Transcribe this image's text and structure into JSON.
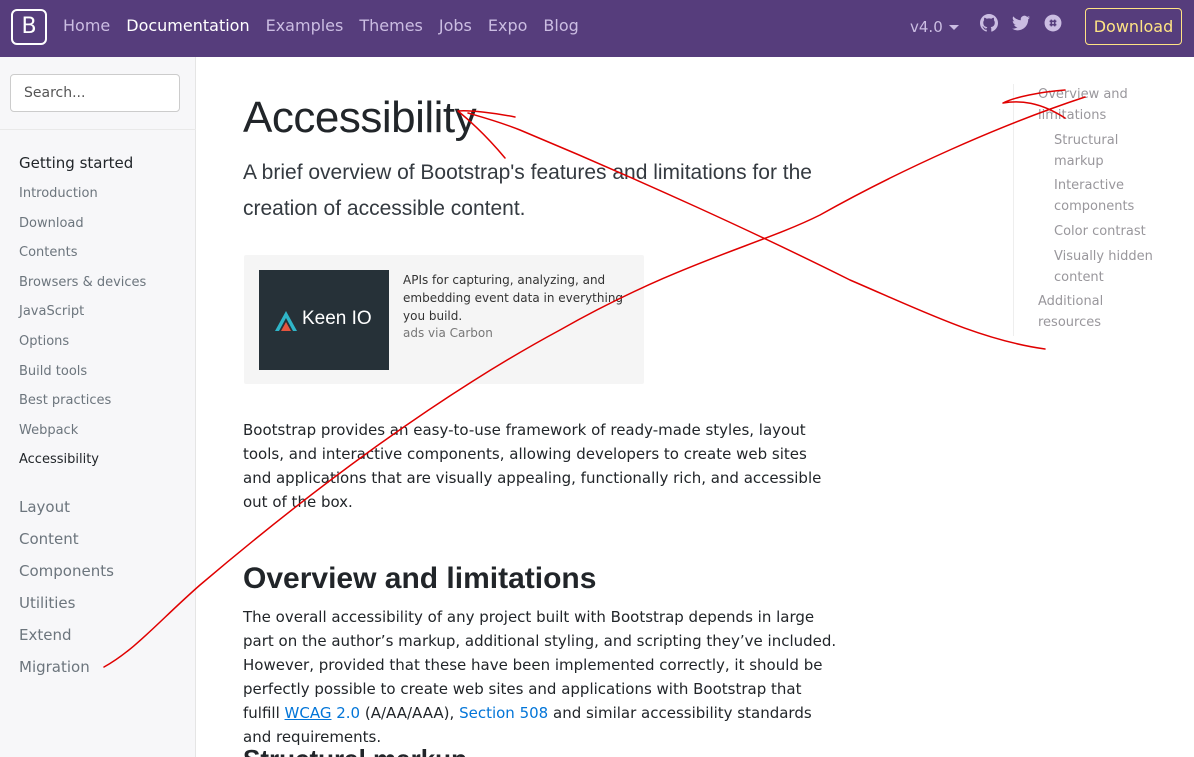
{
  "navbar": {
    "brand": "B",
    "links": [
      "Home",
      "Documentation",
      "Examples",
      "Themes",
      "Jobs",
      "Expo",
      "Blog"
    ],
    "active_link": "Documentation",
    "version": "v4.0",
    "download": "Download",
    "colors": {
      "background": "#563d7c",
      "download_border": "#ffe484"
    }
  },
  "sidebar": {
    "search_placeholder": "Search...",
    "getting_started": "Getting started",
    "items": [
      "Introduction",
      "Download",
      "Contents",
      "Browsers & devices",
      "JavaScript",
      "Options",
      "Build tools",
      "Best practices",
      "Webpack",
      "Accessibility"
    ],
    "groups": [
      "Layout",
      "Content",
      "Components",
      "Utilities",
      "Extend",
      "Migration"
    ]
  },
  "main": {
    "title": "Accessibility",
    "lead": "A brief overview of Bootstrap's features and limitations for the creation of accessible content.",
    "ad": {
      "logo_text": "Keen IO",
      "text": "APIs for capturing, analyzing, and embedding event data in everything you build.",
      "via": "ads via Carbon"
    },
    "intro": "Bootstrap provides an easy-to-use framework of ready-made styles, layout tools, and interactive components, allowing developers to create web sites and applications that are visually appealing, functionally rich, and accessible out of the box.",
    "section_title": "Overview and limitations",
    "section_para_1": "The overall accessibility of any project built with Bootstrap depends in large part on the author’s markup, additional styling, and scripting they’ve included. However, provided that these have been implemented correctly, it should be perfectly possible to create web sites and applications with Bootstrap that fulfill",
    "wcag_link": "WCAG",
    "wcag_version": "2.0",
    "section_para_2": "(A/AA/AAA),",
    "section508_link": "Section 508",
    "section_para_3": "and similar accessibility standards and requirements.",
    "next_heading_partial": "Structural markup"
  },
  "toc": {
    "items": [
      {
        "label": "Overview and limitations",
        "level": 1
      },
      {
        "label": "Structural markup",
        "level": 2
      },
      {
        "label": "Interactive components",
        "level": 2
      },
      {
        "label": "Color contrast",
        "level": 2
      },
      {
        "label": "Visually hidden content",
        "level": 2
      },
      {
        "label": "Additional resources",
        "level": 1
      }
    ]
  },
  "annotation_color": "#e00000"
}
